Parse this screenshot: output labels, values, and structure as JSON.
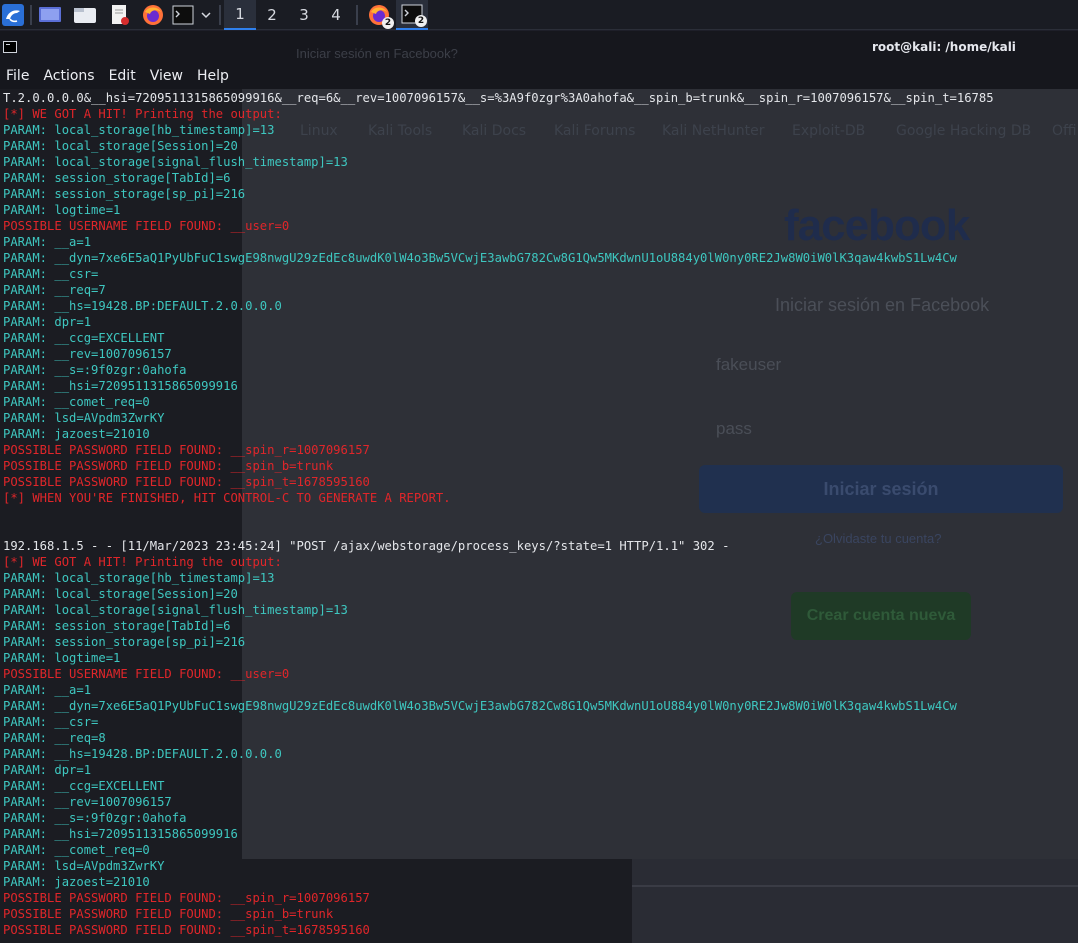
{
  "taskbar": {
    "workspaces": [
      "1",
      "2",
      "3",
      "4"
    ],
    "active_workspace": "1",
    "firefox_badge": "2",
    "terminal_badge": "2"
  },
  "window": {
    "title": "root@kali: /home/kali"
  },
  "menu": [
    "File",
    "Actions",
    "Edit",
    "View",
    "Help"
  ],
  "background_browser": {
    "tab_title": "Iniciar sesión en Facebook?",
    "bookmarks": [
      "Linux",
      "Kali Tools",
      "Kali Docs",
      "Kali Forums",
      "Kali NetHunter",
      "Exploit-DB",
      "Google Hacking DB",
      "Offi"
    ],
    "logo": "facebook",
    "heading": "Iniciar sesión en Facebook",
    "username": "fakeuser",
    "password": "pass",
    "login_button": "Iniciar sesión",
    "forgot_link": "¿Olvidaste tu cuenta?",
    "create_button": "Crear cuenta nueva"
  },
  "terminal": {
    "lines": [
      {
        "t": "T.2.0.0.0.0&__hsi=7209511315865099916&__req=6&__rev=1007096157&__s=%3A9f0zgr%3A0ahofa&__spin_b=trunk&__spin_r=1007096157&__spin_t=16785",
        "c": "white"
      },
      {
        "t": "[*] WE GOT A HIT! Printing the output:",
        "c": "red"
      },
      {
        "t": "PARAM: local_storage[hb_timestamp]=13",
        "c": "teal"
      },
      {
        "t": "PARAM: local_storage[Session]=20",
        "c": "teal"
      },
      {
        "t": "PARAM: local_storage[signal_flush_timestamp]=13",
        "c": "teal"
      },
      {
        "t": "PARAM: session_storage[TabId]=6",
        "c": "teal"
      },
      {
        "t": "PARAM: session_storage[sp_pi]=216",
        "c": "teal"
      },
      {
        "t": "PARAM: logtime=1",
        "c": "teal"
      },
      {
        "t": "POSSIBLE USERNAME FIELD FOUND: __user=0",
        "c": "red"
      },
      {
        "t": "PARAM: __a=1",
        "c": "teal"
      },
      {
        "t": "PARAM: __dyn=7xe6E5aQ1PyUbFuC1swgE98nwgU29zEdEc8uwdK0lW4o3Bw5VCwjE3awbG782Cw8G1Qw5MKdwnU1oU884y0lW0ny0RE2Jw8W0iW0lK3qaw4kwbS1Lw4Cw",
        "c": "teal"
      },
      {
        "t": "PARAM: __csr=",
        "c": "teal"
      },
      {
        "t": "PARAM: __req=7",
        "c": "teal"
      },
      {
        "t": "PARAM: __hs=19428.BP:DEFAULT.2.0.0.0.0",
        "c": "teal"
      },
      {
        "t": "PARAM: dpr=1",
        "c": "teal"
      },
      {
        "t": "PARAM: __ccg=EXCELLENT",
        "c": "teal"
      },
      {
        "t": "PARAM: __rev=1007096157",
        "c": "teal"
      },
      {
        "t": "PARAM: __s=:9f0zgr:0ahofa",
        "c": "teal"
      },
      {
        "t": "PARAM: __hsi=7209511315865099916",
        "c": "teal"
      },
      {
        "t": "PARAM: __comet_req=0",
        "c": "teal"
      },
      {
        "t": "PARAM: lsd=AVpdm3ZwrKY",
        "c": "teal"
      },
      {
        "t": "PARAM: jazoest=21010",
        "c": "teal"
      },
      {
        "t": "POSSIBLE PASSWORD FIELD FOUND: __spin_r=1007096157",
        "c": "red"
      },
      {
        "t": "POSSIBLE PASSWORD FIELD FOUND: __spin_b=trunk",
        "c": "red"
      },
      {
        "t": "POSSIBLE PASSWORD FIELD FOUND: __spin_t=1678595160",
        "c": "red"
      },
      {
        "t": "[*] WHEN YOU'RE FINISHED, HIT CONTROL-C TO GENERATE A REPORT.",
        "c": "red"
      },
      {
        "t": "",
        "c": "white"
      },
      {
        "t": "",
        "c": "white"
      },
      {
        "t": "192.168.1.5 - - [11/Mar/2023 23:45:24] \"POST /ajax/webstorage/process_keys/?state=1 HTTP/1.1\" 302 -",
        "c": "white"
      },
      {
        "t": "[*] WE GOT A HIT! Printing the output:",
        "c": "red"
      },
      {
        "t": "PARAM: local_storage[hb_timestamp]=13",
        "c": "teal"
      },
      {
        "t": "PARAM: local_storage[Session]=20",
        "c": "teal"
      },
      {
        "t": "PARAM: local_storage[signal_flush_timestamp]=13",
        "c": "teal"
      },
      {
        "t": "PARAM: session_storage[TabId]=6",
        "c": "teal"
      },
      {
        "t": "PARAM: session_storage[sp_pi]=216",
        "c": "teal"
      },
      {
        "t": "PARAM: logtime=1",
        "c": "teal"
      },
      {
        "t": "POSSIBLE USERNAME FIELD FOUND: __user=0",
        "c": "red"
      },
      {
        "t": "PARAM: __a=1",
        "c": "teal"
      },
      {
        "t": "PARAM: __dyn=7xe6E5aQ1PyUbFuC1swgE98nwgU29zEdEc8uwdK0lW4o3Bw5VCwjE3awbG782Cw8G1Qw5MKdwnU1oU884y0lW0ny0RE2Jw8W0iW0lK3qaw4kwbS1Lw4Cw",
        "c": "teal"
      },
      {
        "t": "PARAM: __csr=",
        "c": "teal"
      },
      {
        "t": "PARAM: __req=8",
        "c": "teal"
      },
      {
        "t": "PARAM: __hs=19428.BP:DEFAULT.2.0.0.0.0",
        "c": "teal"
      },
      {
        "t": "PARAM: dpr=1",
        "c": "teal"
      },
      {
        "t": "PARAM: __ccg=EXCELLENT",
        "c": "teal"
      },
      {
        "t": "PARAM: __rev=1007096157",
        "c": "teal"
      },
      {
        "t": "PARAM: __s=:9f0zgr:0ahofa",
        "c": "teal"
      },
      {
        "t": "PARAM: __hsi=7209511315865099916",
        "c": "teal"
      },
      {
        "t": "PARAM: __comet_req=0",
        "c": "teal"
      },
      {
        "t": "PARAM: lsd=AVpdm3ZwrKY",
        "c": "teal"
      },
      {
        "t": "PARAM: jazoest=21010",
        "c": "teal"
      },
      {
        "t": "POSSIBLE PASSWORD FIELD FOUND: __spin_r=1007096157",
        "c": "red"
      },
      {
        "t": "POSSIBLE PASSWORD FIELD FOUND: __spin_b=trunk",
        "c": "red"
      },
      {
        "t": "POSSIBLE PASSWORD FIELD FOUND: __spin_t=1678595160",
        "c": "red"
      }
    ]
  },
  "colors": {
    "terminal_bg": "#1b1c22",
    "text_white": "#e4e6ea",
    "text_red": "#e0262a",
    "text_teal": "#3ec7c0",
    "accent_blue": "#2f80ed"
  }
}
